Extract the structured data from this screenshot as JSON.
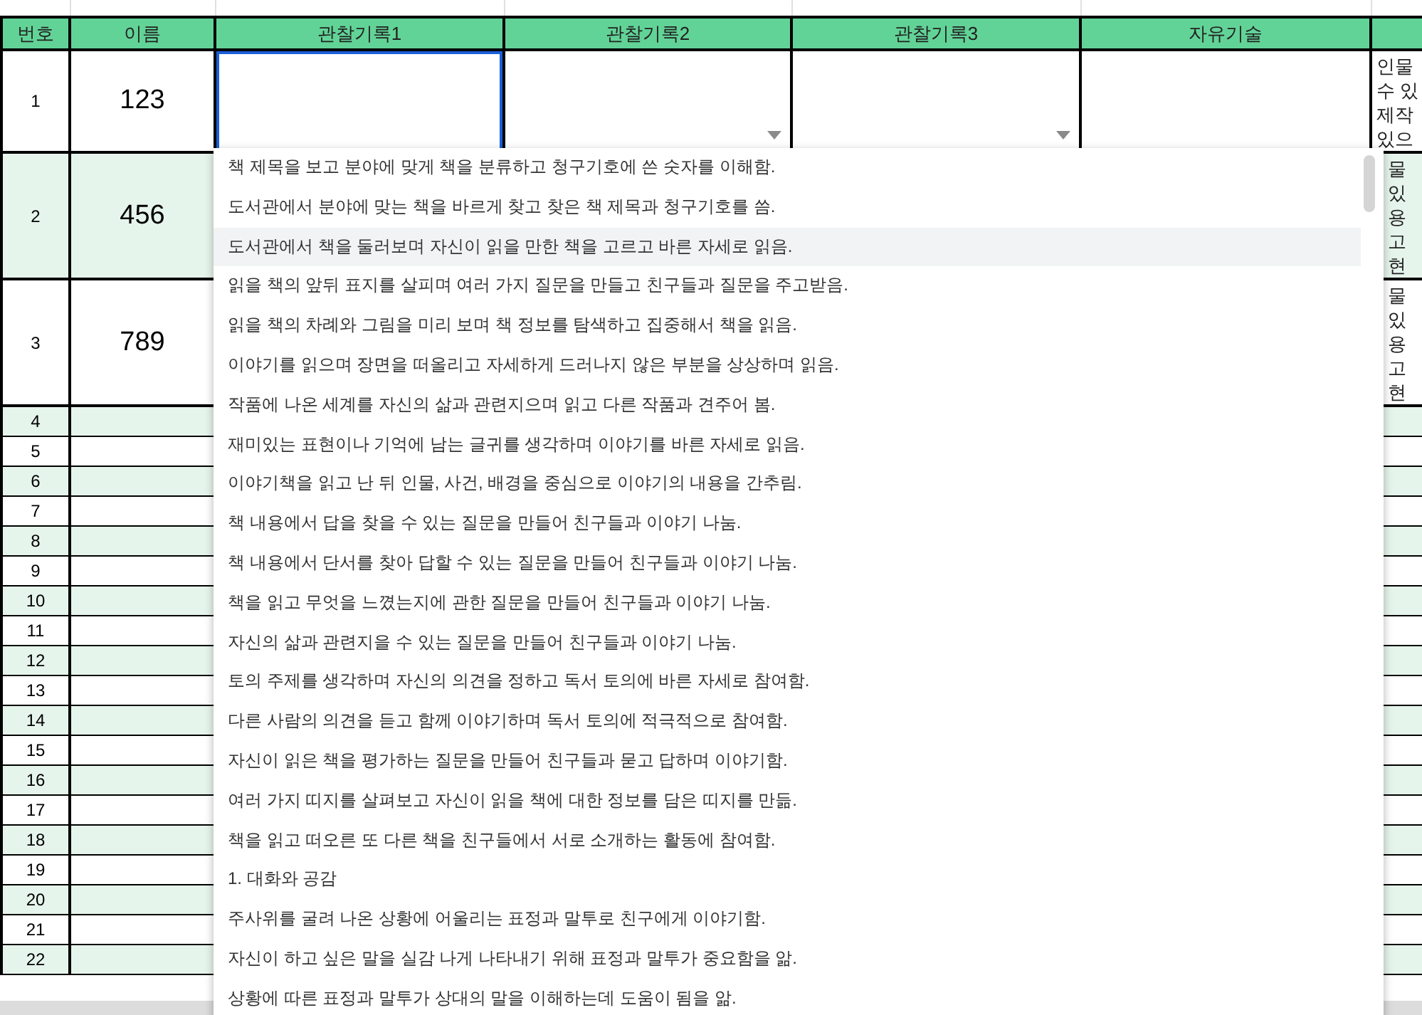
{
  "table": {
    "columns": [
      "번호",
      "이름",
      "관찰기록1",
      "관찰기록2",
      "관찰기록3",
      "자유기술"
    ],
    "rows": [
      {
        "number": "1",
        "name": "123",
        "cells": [
          {
            "selected": true,
            "dropdown": false
          },
          {
            "selected": false,
            "dropdown": true
          },
          {
            "selected": false,
            "dropdown": true
          },
          {
            "selected": false,
            "dropdown": false
          }
        ],
        "note_lines": [
          "인물",
          "수 있",
          "제작",
          "있으"
        ]
      },
      {
        "number": "2",
        "name": "456",
        "note_lines": [
          "물",
          "있",
          "용",
          "고",
          "현"
        ]
      },
      {
        "number": "3",
        "name": "789",
        "note_lines": [
          "물",
          "있",
          "용",
          "고",
          "현"
        ]
      },
      {
        "number": "4"
      },
      {
        "number": "5"
      },
      {
        "number": "6"
      },
      {
        "number": "7"
      },
      {
        "number": "8"
      },
      {
        "number": "9"
      },
      {
        "number": "10"
      },
      {
        "number": "11"
      },
      {
        "number": "12"
      },
      {
        "number": "13"
      },
      {
        "number": "14"
      },
      {
        "number": "15"
      },
      {
        "number": "16"
      },
      {
        "number": "17"
      },
      {
        "number": "18"
      },
      {
        "number": "19"
      },
      {
        "number": "20"
      },
      {
        "number": "21"
      },
      {
        "number": "22"
      }
    ]
  },
  "dropdown": {
    "options": [
      {
        "label": "책 제목을 보고 분야에 맞게 책을 분류하고 청구기호에 쓴 숫자를 이해함.",
        "selected": false
      },
      {
        "label": "도서관에서 분야에 맞는 책을 바르게 찾고 찾은 책 제목과 청구기호를 씀.",
        "selected": false
      },
      {
        "label": "도서관에서 책을 둘러보며 자신이 읽을 만한 책을 고르고 바른 자세로 읽음.",
        "selected": true
      },
      {
        "label": "읽을 책의 앞뒤 표지를 살피며 여러 가지 질문을 만들고 친구들과 질문을 주고받음.",
        "selected": false
      },
      {
        "label": "읽을 책의 차례와 그림을 미리 보며 책 정보를 탐색하고 집중해서 책을 읽음.",
        "selected": false
      },
      {
        "label": "이야기를 읽으며 장면을 떠올리고 자세하게 드러나지 않은 부분을 상상하며 읽음.",
        "selected": false
      },
      {
        "label": "작품에 나온 세계를 자신의 삶과 관련지으며 읽고 다른 작품과 견주어 봄.",
        "selected": false
      },
      {
        "label": "재미있는 표현이나 기억에 남는 글귀를 생각하며 이야기를 바른 자세로 읽음.",
        "selected": false
      },
      {
        "label": "이야기책을 읽고 난 뒤 인물, 사건, 배경을 중심으로 이야기의 내용을 간추림.",
        "selected": false
      },
      {
        "label": "책 내용에서 답을 찾을 수 있는 질문을 만들어 친구들과 이야기 나눔.",
        "selected": false
      },
      {
        "label": "책 내용에서 단서를 찾아 답할 수 있는 질문을 만들어 친구들과 이야기 나눔.",
        "selected": false
      },
      {
        "label": "책을 읽고 무엇을 느꼈는지에 관한 질문을 만들어 친구들과 이야기 나눔.",
        "selected": false
      },
      {
        "label": "자신의 삶과 관련지을 수 있는 질문을 만들어 친구들과 이야기 나눔.",
        "selected": false
      },
      {
        "label": "토의 주제를 생각하며 자신의 의견을 정하고 독서 토의에 바른 자세로 참여함.",
        "selected": false
      },
      {
        "label": "다른 사람의 의견을 듣고 함께 이야기하며 독서 토의에 적극적으로 참여함.",
        "selected": false
      },
      {
        "label": "자신이 읽은 책을 평가하는 질문을 만들어 친구들과 묻고 답하며 이야기함.",
        "selected": false
      },
      {
        "label": "여러 가지 띠지를 살펴보고 자신이 읽을 책에 대한 정보를 담은 띠지를 만듦.",
        "selected": false
      },
      {
        "label": "책을 읽고 떠오른 또 다른 책을 친구들에서 서로 소개하는 활동에 참여함.",
        "selected": false
      },
      {
        "label": "1. 대화와 공감",
        "selected": false
      },
      {
        "label": "주사위를 굴려 나온 상황에 어울리는 표정과 말투로 친구에게 이야기함.",
        "selected": false
      },
      {
        "label": "자신이 하고 싶은 말을 실감 나게 나타내기 위해 표정과 말투가 중요함을 앎.",
        "selected": false
      },
      {
        "label": "상황에 따른 표정과 말투가 상대의 말을 이해하는데 도움이 됨을 앎.",
        "selected": false
      }
    ]
  }
}
